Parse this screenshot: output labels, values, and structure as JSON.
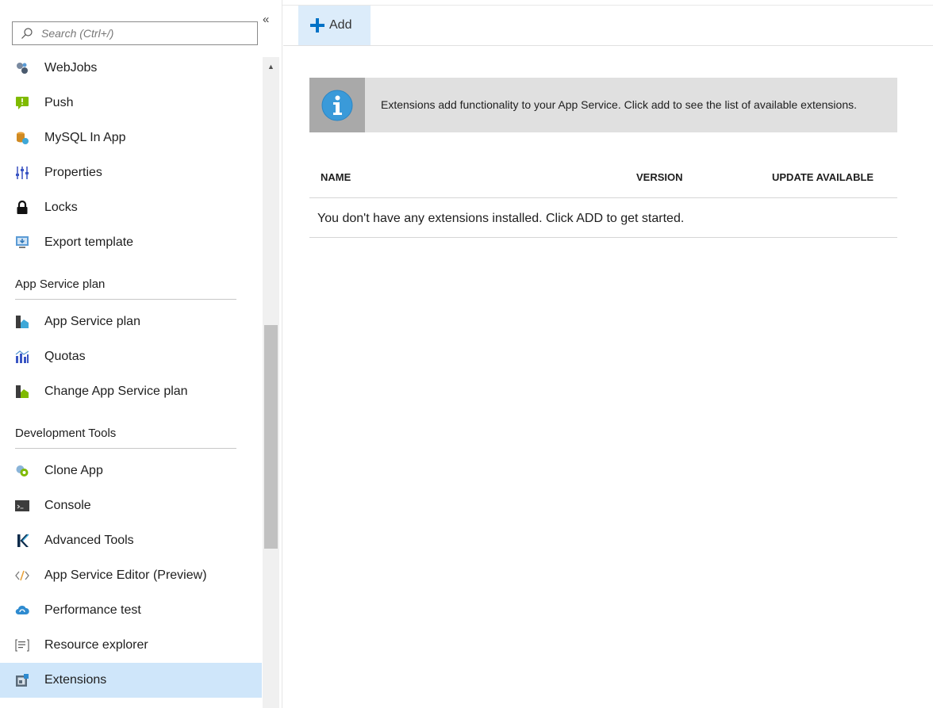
{
  "sidebar": {
    "search_placeholder": "Search (Ctrl+/)",
    "collapse_glyph": "«",
    "items_top": [
      {
        "label": "WebJobs",
        "icon": "webjobs-icon"
      },
      {
        "label": "Push",
        "icon": "push-icon"
      },
      {
        "label": "MySQL In App",
        "icon": "mysql-icon"
      },
      {
        "label": "Properties",
        "icon": "properties-icon"
      },
      {
        "label": "Locks",
        "icon": "lock-icon"
      },
      {
        "label": "Export template",
        "icon": "export-template-icon"
      }
    ],
    "section_plan": {
      "title": "App Service plan",
      "items": [
        {
          "label": "App Service plan",
          "icon": "app-service-plan-icon"
        },
        {
          "label": "Quotas",
          "icon": "quotas-icon"
        },
        {
          "label": "Change App Service plan",
          "icon": "change-plan-icon"
        }
      ]
    },
    "section_dev": {
      "title": "Development Tools",
      "items": [
        {
          "label": "Clone App",
          "icon": "clone-app-icon"
        },
        {
          "label": "Console",
          "icon": "console-icon"
        },
        {
          "label": "Advanced Tools",
          "icon": "kudu-icon"
        },
        {
          "label": "App Service Editor (Preview)",
          "icon": "code-editor-icon"
        },
        {
          "label": "Performance test",
          "icon": "cloud-icon"
        },
        {
          "label": "Resource explorer",
          "icon": "resource-explorer-icon"
        },
        {
          "label": "Extensions",
          "icon": "extensions-icon",
          "selected": true
        }
      ]
    }
  },
  "toolbar": {
    "add_label": "Add"
  },
  "banner": {
    "text": "Extensions add functionality to your App Service. Click add to see the list of available extensions."
  },
  "table": {
    "columns": [
      "NAME",
      "VERSION",
      "UPDATE AVAILABLE"
    ],
    "empty_message": "You don't have any extensions installed. Click ADD to get started."
  },
  "colors": {
    "accent": "#0072c6",
    "selected_bg": "#cfe6fa",
    "banner_bg": "#e0e0e0"
  }
}
